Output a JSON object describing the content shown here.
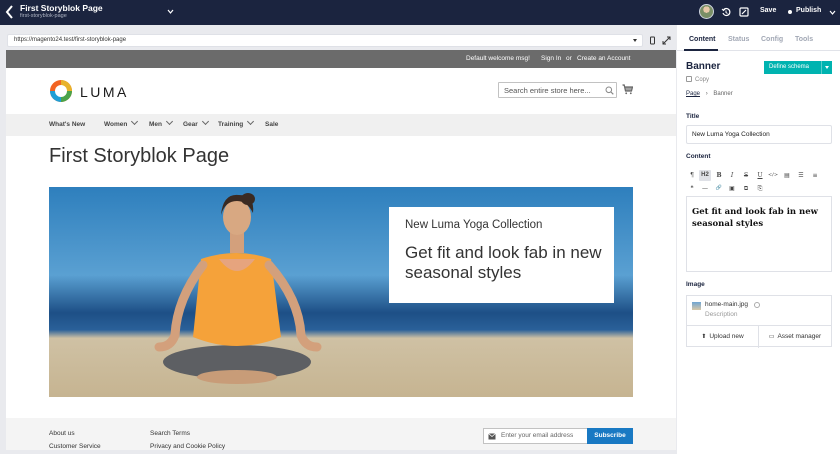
{
  "topbar": {
    "title": "First Storyblok Page",
    "slug": "first-storyblok-page",
    "save_label": "Save",
    "publish_label": "Publish"
  },
  "urlbar": {
    "url": "https://magento24.test/first-storyblok-page"
  },
  "preview": {
    "panel": {
      "welcome": "Default welcome msg!",
      "sign_in": "Sign In",
      "or": "or",
      "create_account": "Create an Account"
    },
    "logo_text": "LUMA",
    "search_placeholder": "Search entire store here...",
    "nav": [
      {
        "label": "What's New",
        "has_menu": false
      },
      {
        "label": "Women",
        "has_menu": true
      },
      {
        "label": "Men",
        "has_menu": true
      },
      {
        "label": "Gear",
        "has_menu": true
      },
      {
        "label": "Training",
        "has_menu": true
      },
      {
        "label": "Sale",
        "has_menu": false
      }
    ],
    "page_title": "First Storyblok Page",
    "hero": {
      "kicker": "New Luma Yoga Collection",
      "headline": "Get fit and look fab in new seasonal styles"
    },
    "footer": {
      "col1": [
        "About us",
        "Customer Service"
      ],
      "col2": [
        "Search Terms",
        "Privacy and Cookie Policy"
      ],
      "newsletter_placeholder": "Enter your email address",
      "subscribe_label": "Subscribe"
    }
  },
  "sidebar": {
    "tabs": [
      {
        "label": "Content",
        "active": true
      },
      {
        "label": "Status",
        "active": false
      },
      {
        "label": "Config",
        "active": false
      },
      {
        "label": "Tools",
        "active": false
      }
    ],
    "block_title": "Banner",
    "define_schema_label": "Define schema",
    "copy_label": "Copy",
    "breadcrumb": [
      "Page",
      "Banner"
    ],
    "title_label": "Title",
    "title_value": "New Luma Yoga Collection",
    "content_label": "Content",
    "toolbar_row1": [
      "¶",
      "H2",
      "B",
      "I",
      "S",
      "U",
      "</>",
      "▤",
      "☰",
      "≡"
    ],
    "toolbar_row2": [
      "❝",
      "—",
      "🔗",
      "▣",
      "⧉",
      "⎘"
    ],
    "content_value": "Get fit and look fab in new seasonal styles",
    "image_label": "Image",
    "image_filename": "home-main.jpg",
    "image_description": "Description",
    "upload_label": "Upload new",
    "asset_manager_label": "Asset manager"
  },
  "colors": {
    "topbar": "#1b243f",
    "accent_teal": "#00b3b0",
    "luma_blue": "#1979c3"
  }
}
